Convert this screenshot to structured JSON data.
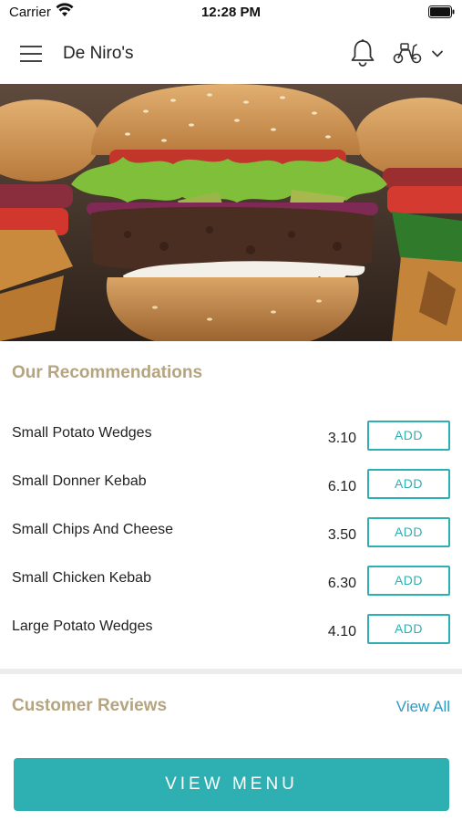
{
  "status_bar": {
    "carrier": "Carrier",
    "time": "12:28 PM"
  },
  "header": {
    "title": "De Niro's",
    "icons": [
      "menu-icon",
      "bell-icon",
      "scooter-icon",
      "chevron-down-icon"
    ]
  },
  "hero": {
    "image": "burger-photo"
  },
  "recommendations": {
    "title": "Our Recommendations",
    "items": [
      {
        "name": "Small Potato Wedges",
        "price": "3.10",
        "button": "ADD"
      },
      {
        "name": "Small Donner Kebab",
        "price": "6.10",
        "button": "ADD"
      },
      {
        "name": "Small Chips And Cheese",
        "price": "3.50",
        "button": "ADD"
      },
      {
        "name": "Small Chicken Kebab",
        "price": "6.30",
        "button": "ADD"
      },
      {
        "name": "Large Potato Wedges",
        "price": "4.10",
        "button": "ADD"
      }
    ]
  },
  "reviews": {
    "title": "Customer Reviews",
    "view_all": "View All"
  },
  "footer": {
    "view_menu": "VIEW MENU"
  },
  "colors": {
    "accent": "#2eb0b3",
    "heading": "#b4a47f",
    "link": "#2a9cc5"
  }
}
